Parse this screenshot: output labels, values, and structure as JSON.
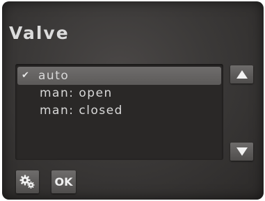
{
  "screen": {
    "title": "Valve"
  },
  "options": {
    "items": [
      {
        "label": "auto",
        "selected": true,
        "check": "✔"
      },
      {
        "label": "man: open",
        "selected": false
      },
      {
        "label": "man: closed",
        "selected": false
      }
    ]
  },
  "buttons": {
    "ok_label": "OK",
    "scroll_up_icon": "triangle-up-icon",
    "scroll_down_icon": "triangle-down-icon",
    "settings_icon": "gears-icon"
  },
  "colors": {
    "background": "#3b3938",
    "selection": "#6f6d6c",
    "text": "#d9d9d9"
  }
}
